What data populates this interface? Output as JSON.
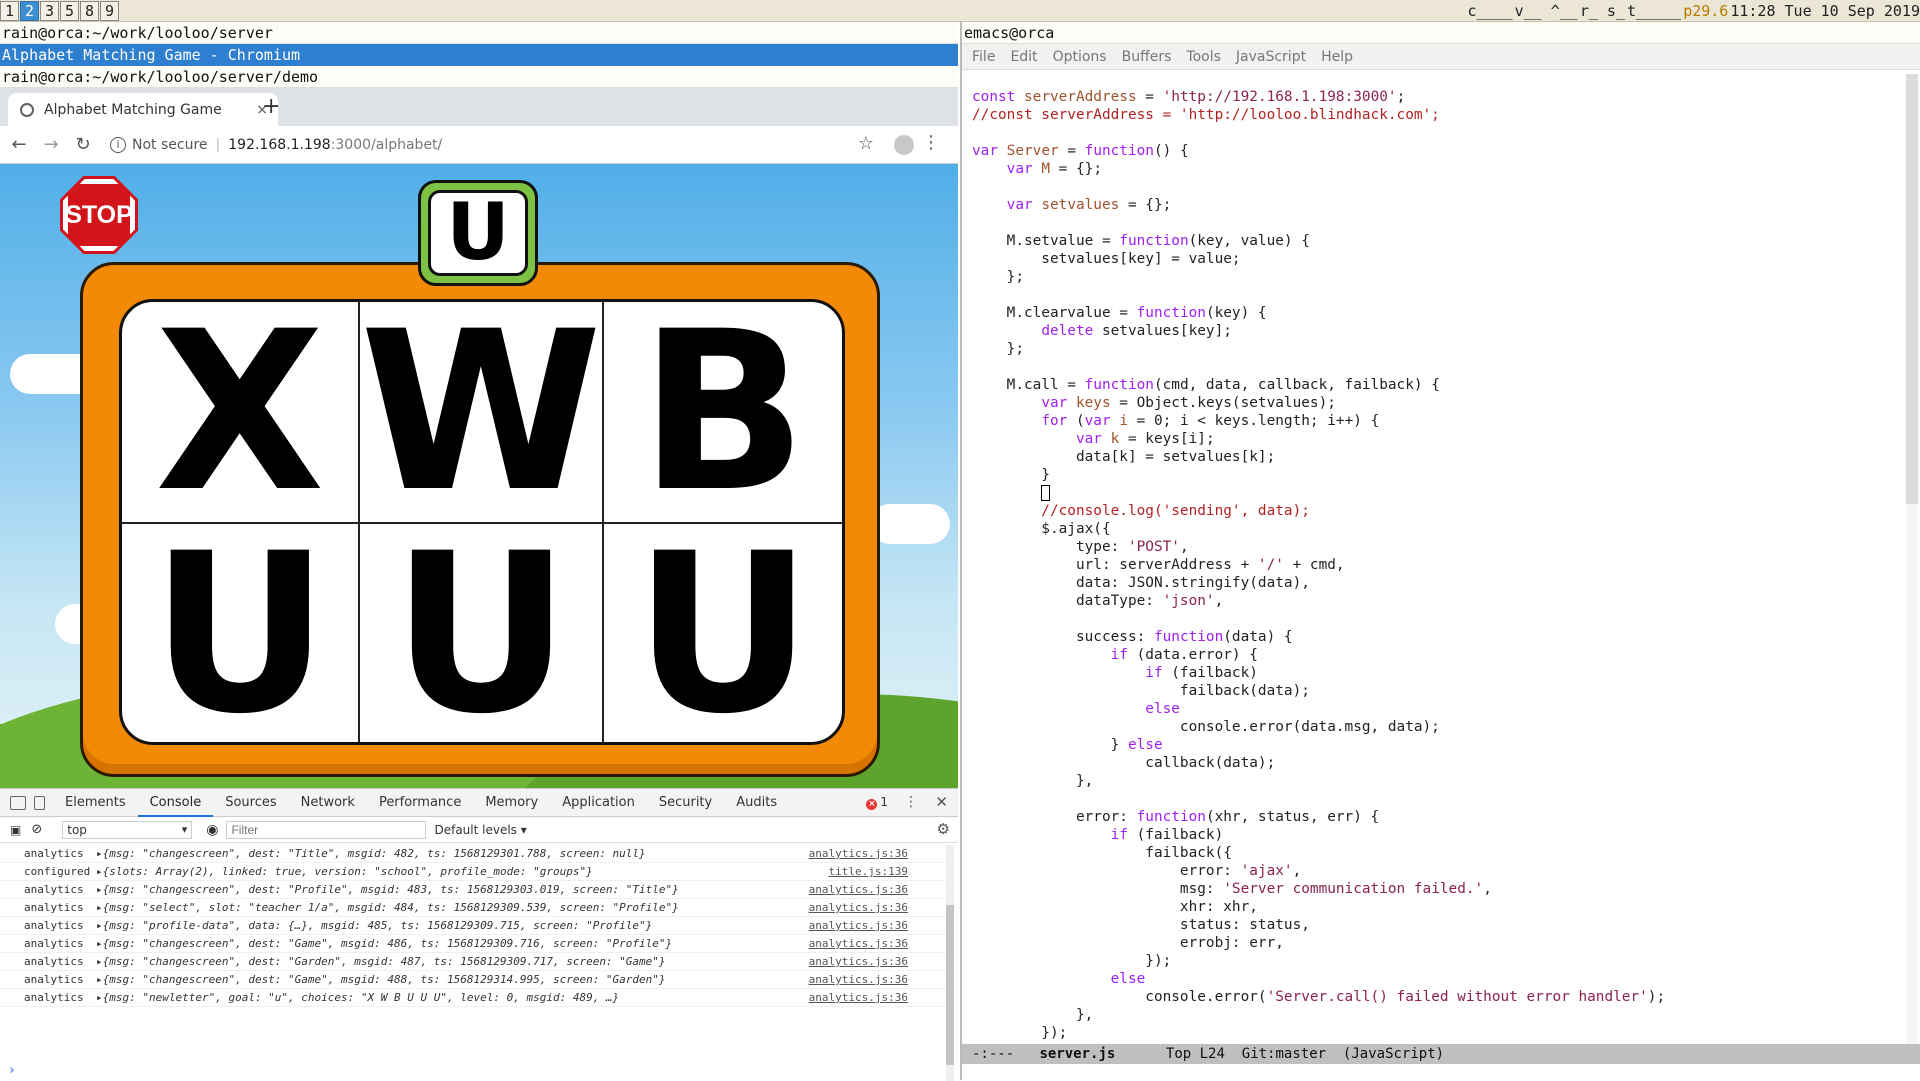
{
  "topbar": {
    "workspaces": [
      "1",
      "2",
      "3",
      "5",
      "8",
      "9"
    ],
    "active_workspace": "2",
    "status": {
      "c": "c____",
      "v": "v__ ^__",
      "r": "r_ s_",
      "t": "t_____",
      "p": "p29.6",
      "clock": "11:28 Tue 10 Sep 2019"
    }
  },
  "left": {
    "term1": "rain@orca:~/work/looloo/server",
    "window_title": "Alphabet Matching Game - Chromium",
    "term2": "rain@orca:~/work/looloo/server/demo",
    "tab_title": "Alphabet Matching Game",
    "tab_close": "×",
    "new_tab": "+",
    "not_secure": "Not secure",
    "url_host": "192.168.1.198",
    "url_path": ":3000/alphabet/",
    "game": {
      "stop_label": "STOP",
      "target_letter": "U",
      "cells": [
        "X",
        "W",
        "B",
        "U",
        "U",
        "U"
      ]
    },
    "devtools": {
      "tabs": [
        "Elements",
        "Console",
        "Sources",
        "Network",
        "Performance",
        "Memory",
        "Application",
        "Security",
        "Audits"
      ],
      "active_tab": "Console",
      "error_count": "1",
      "context": "top",
      "filter_placeholder": "Filter",
      "levels": "Default levels ▾",
      "logs": [
        {
          "src": "analytics",
          "msg": "▸{msg: \"changescreen\", dest: \"Title\", msgid: 482, ts: 1568129301.788, screen: null}",
          "file": "analytics.js:36"
        },
        {
          "src": "configured",
          "msg": "▸{slots: Array(2), linked: true, version: \"school\", profile_mode: \"groups\"}",
          "file": "title.js:139"
        },
        {
          "src": "analytics",
          "msg": "▸{msg: \"changescreen\", dest: \"Profile\", msgid: 483, ts: 1568129303.019, screen: \"Title\"}",
          "file": "analytics.js:36"
        },
        {
          "src": "analytics",
          "msg": "▸{msg: \"select\", slot: \"teacher 1/a\", msgid: 484, ts: 1568129309.539, screen: \"Profile\"}",
          "file": "analytics.js:36"
        },
        {
          "src": "analytics",
          "msg": "▸{msg: \"profile-data\", data: {…}, msgid: 485, ts: 1568129309.715, screen: \"Profile\"}",
          "file": "analytics.js:36"
        },
        {
          "src": "analytics",
          "msg": "▸{msg: \"changescreen\", dest: \"Game\", msgid: 486, ts: 1568129309.716, screen: \"Profile\"}",
          "file": "analytics.js:36"
        },
        {
          "src": "analytics",
          "msg": "▸{msg: \"changescreen\", dest: \"Garden\", msgid: 487, ts: 1568129309.717, screen: \"Game\"}",
          "file": "analytics.js:36"
        },
        {
          "src": "analytics",
          "msg": "▸{msg: \"changescreen\", dest: \"Game\", msgid: 488, ts: 1568129314.995, screen: \"Garden\"}",
          "file": "analytics.js:36"
        },
        {
          "src": "analytics",
          "msg": "▸{msg: \"newletter\", goal: \"u\", choices: \"X W B U U U\", level: 0, msgid: 489, …}",
          "file": "analytics.js:36"
        }
      ],
      "prompt": "›"
    }
  },
  "right": {
    "title": "emacs@orca",
    "menu": [
      "File",
      "Edit",
      "Options",
      "Buffers",
      "Tools",
      "JavaScript",
      "Help"
    ],
    "code_lines": [
      "const serverAddress = 'http://192.168.1.198:3000';",
      "//const serverAddress = 'http://looloo.blindhack.com';",
      "",
      "var Server = function() {",
      "    var M = {};",
      "",
      "    var setvalues = {};",
      "",
      "    M.setvalue = function(key, value) {",
      "        setvalues[key] = value;",
      "    };",
      "",
      "    M.clearvalue = function(key) {",
      "        delete setvalues[key];",
      "    };",
      "",
      "    M.call = function(cmd, data, callback, failback) {",
      "        var keys = Object.keys(setvalues);",
      "        for (var i = 0; i < keys.length; i++) {",
      "            var k = keys[i];",
      "            data[k] = setvalues[k];",
      "        }",
      "",
      "        //console.log('sending', data);",
      "        $.ajax({",
      "            type: 'POST',",
      "            url: serverAddress + '/' + cmd,",
      "            data: JSON.stringify(data),",
      "            dataType: 'json',",
      "",
      "            success: function(data) {",
      "                if (data.error) {",
      "                    if (failback)",
      "                        failback(data);",
      "                    else",
      "                        console.error(data.msg, data);",
      "                } else",
      "                    callback(data);",
      "            },",
      "",
      "            error: function(xhr, status, err) {",
      "                if (failback)",
      "                    failback({",
      "                        error: 'ajax',",
      "                        msg: 'Server communication failed.',",
      "                        xhr: xhr,",
      "                        status: status,",
      "                        errobj: err,",
      "                    });",
      "                else",
      "                    console.error('Server.call() failed without error handler');",
      "            },",
      "        });"
    ],
    "modeline": {
      "state": "-:---",
      "buffer": "server.js",
      "position": "Top L24",
      "vc": "Git:master",
      "mode": "(JavaScript)"
    }
  }
}
